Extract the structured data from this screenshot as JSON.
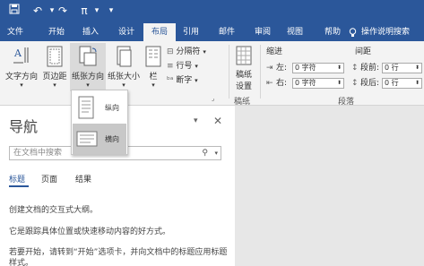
{
  "quick_access": {
    "save_icon": "save-icon",
    "undo_icon": "undo-icon",
    "redo_icon": "redo-icon",
    "pi_label": "π",
    "customize_icon": "chevron-down-icon"
  },
  "tabs": [
    {
      "label": "文件"
    },
    {
      "label": "开始"
    },
    {
      "label": "插入"
    },
    {
      "label": "设计"
    },
    {
      "label": "布局"
    },
    {
      "label": "引用"
    },
    {
      "label": "邮件"
    },
    {
      "label": "审阅"
    },
    {
      "label": "视图"
    },
    {
      "label": "帮助"
    }
  ],
  "tell_me": "操作说明搜索",
  "ribbon": {
    "text_direction": "文字方向",
    "margins": "页边距",
    "orientation": "纸张方向",
    "size": "纸张大小",
    "columns": "栏",
    "breaks": "分隔符",
    "line_numbers": "行号",
    "hyphenation": "断字",
    "draft_paper_line1": "稿纸",
    "draft_paper_line2": "设置",
    "draft_paper_group": "稿纸",
    "indent_header": "缩进",
    "spacing_header": "间距",
    "indent_left_label": "左:",
    "indent_right_label": "右:",
    "indent_left_value": "0 字符",
    "indent_right_value": "0 字符",
    "spacing_before_label": "段前:",
    "spacing_after_label": "段后:",
    "spacing_before_value": "0 行",
    "spacing_after_value": "0 行",
    "paragraph_group": "段落"
  },
  "orientation_menu": {
    "portrait": "纵向",
    "landscape": "横向"
  },
  "nav_pane": {
    "title": "导航",
    "search_placeholder": "在文档中搜索",
    "tabs": [
      "标题",
      "页面",
      "结果"
    ],
    "text1": "创建文档的交互式大纲。",
    "text2": "它是跟踪具体位置或快速移动内容的好方式。",
    "text3": "若要开始，请转到“开始”选项卡，并向文档中的标题应用标题样式。"
  },
  "colors": {
    "accent": "#2b579a",
    "ribbon_bg": "#f3f3f3",
    "doc_bg": "#e7e7e7"
  }
}
